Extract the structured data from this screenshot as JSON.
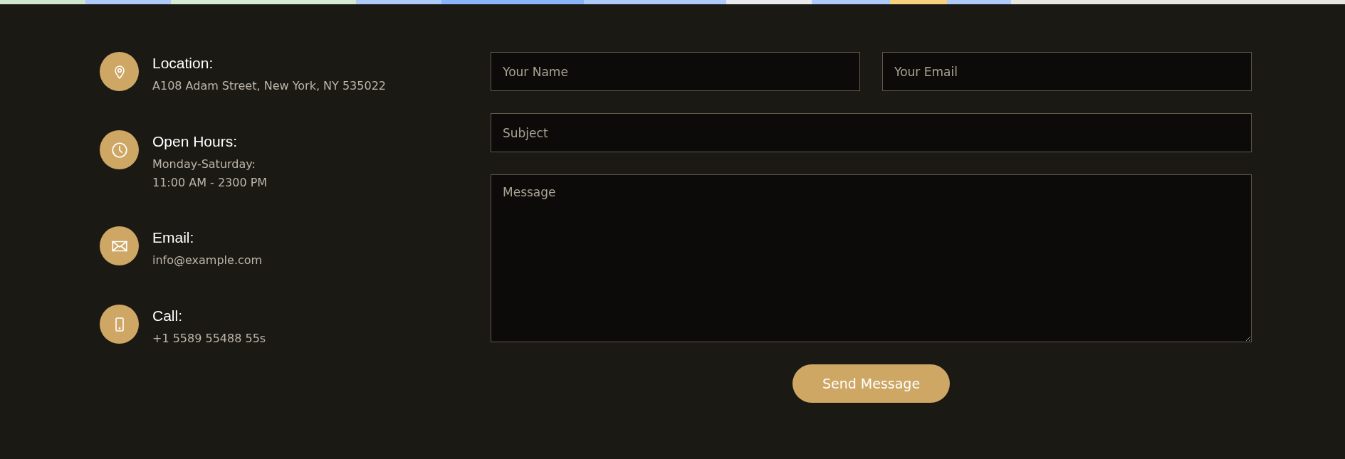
{
  "contact_items": [
    {
      "kind": "location",
      "title": "Location:",
      "lines": [
        "A108 Adam Street, New York, NY 535022"
      ]
    },
    {
      "kind": "hours",
      "title": "Open Hours:",
      "lines": [
        "Monday-Saturday:",
        "11:00 AM - 2300 PM"
      ]
    },
    {
      "kind": "email",
      "title": "Email:",
      "lines": [
        "info@example.com"
      ]
    },
    {
      "kind": "call",
      "title": "Call:",
      "lines": [
        "+1 5589 55488 55s"
      ]
    }
  ],
  "form": {
    "name": {
      "placeholder": "Your Name"
    },
    "email": {
      "placeholder": "Your Email"
    },
    "subject": {
      "placeholder": "Subject"
    },
    "message": {
      "placeholder": "Message"
    },
    "submit": "Send Message"
  }
}
